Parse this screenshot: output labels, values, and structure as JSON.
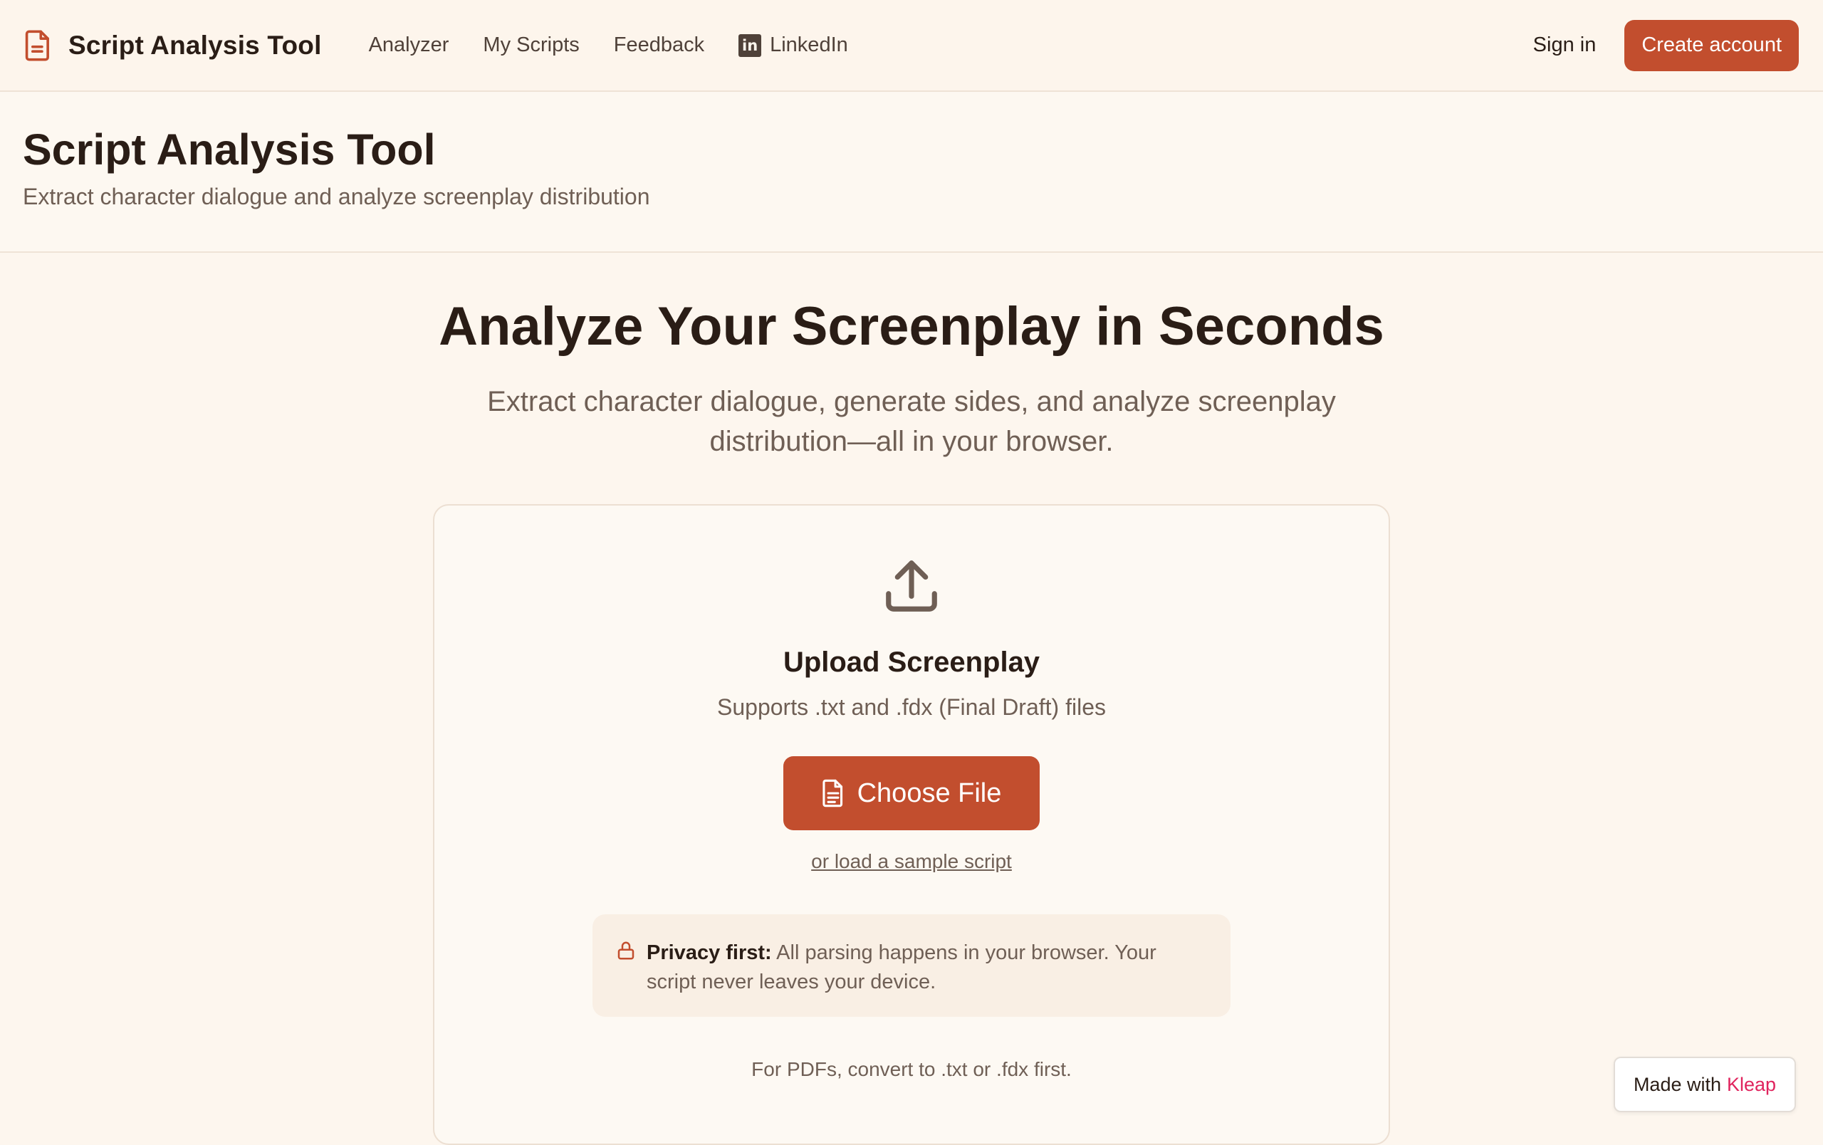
{
  "nav": {
    "brand": "Script Analysis Tool",
    "links": [
      "Analyzer",
      "My Scripts",
      "Feedback"
    ],
    "linkedin": "LinkedIn",
    "signin": "Sign in",
    "create_account": "Create account"
  },
  "header": {
    "title": "Script Analysis Tool",
    "subtitle": "Extract character dialogue and analyze screenplay distribution"
  },
  "hero": {
    "title": "Analyze Your Screenplay in Seconds",
    "subtitle": "Extract character dialogue, generate sides, and analyze screenplay distribution—all in your browser."
  },
  "upload": {
    "title": "Upload Screenplay",
    "supports": "Supports .txt and .fdx (Final Draft) files",
    "choose_file": "Choose File",
    "sample_link": "or load a sample script",
    "privacy_label": "Privacy first:",
    "privacy_text": "All parsing happens in your browser. Your script never leaves your device.",
    "pdf_note": "For PDFs, convert to .txt or .fdx first."
  },
  "badge": {
    "prefix": "Made with",
    "brand": "Kleap"
  },
  "colors": {
    "accent": "#c24e2e",
    "background": "#fdf6ee",
    "text": "#2a1d16",
    "muted": "#6f5f55",
    "kleap": "#e0245e"
  }
}
